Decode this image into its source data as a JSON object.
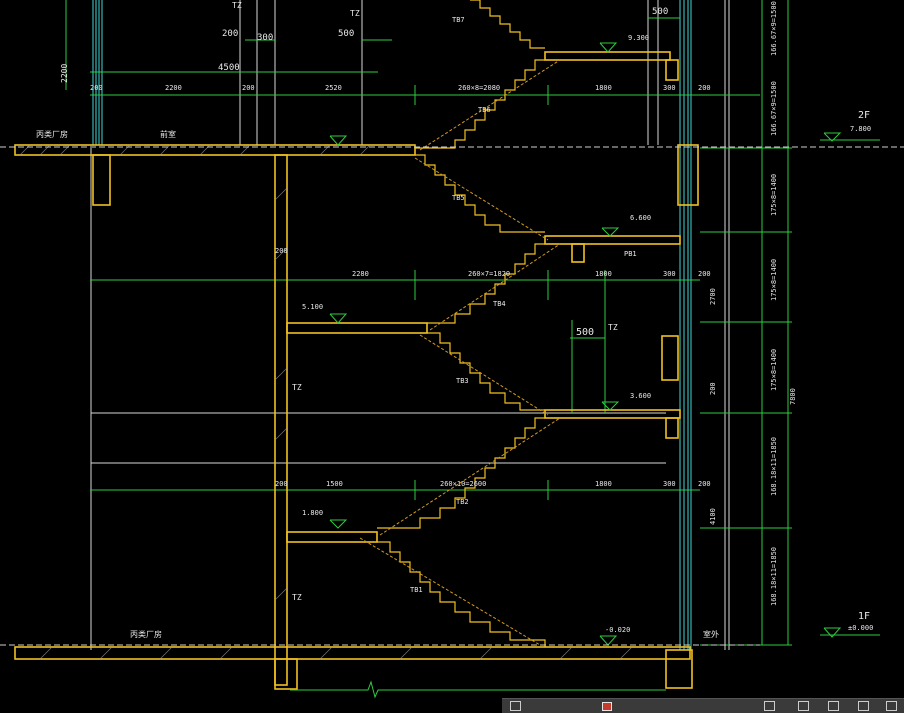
{
  "dims_top": [
    "200",
    "300",
    "500",
    "4500",
    "500",
    "9.300",
    "2200"
  ],
  "dim_row_a": [
    "200",
    "2200",
    "200",
    "2520",
    "260×8=2080",
    "1800",
    "300",
    "200"
  ],
  "dim_row_b": [
    "200",
    "2280",
    "260×7=1820",
    "1800",
    "300",
    "200"
  ],
  "dim_row_c": [
    "200",
    "1500",
    "260×10=2600",
    "1800",
    "300",
    "200"
  ],
  "room_labels": [
    "丙类厂房",
    "前室",
    "丙类厂房",
    "室外"
  ],
  "elevations": [
    "7.800",
    "6.600",
    "5.100",
    "3.600",
    "1.800",
    "-0.020",
    "±0.000"
  ],
  "stair_tags": [
    "TB7",
    "TB6",
    "TB5",
    "TB4",
    "TB3",
    "TB2",
    "TB1",
    "PB1"
  ],
  "column_tags": [
    "TZ",
    "TZ",
    "TZ",
    "TZ",
    "TZ"
  ],
  "right_dims": [
    "166.67×9=1500",
    "166.67×9=1500",
    "175×8=1400",
    "175×8=1400",
    "175×8=1400",
    "168.18×11=1850",
    "168.18×11=1850",
    "2700",
    "7800",
    "4100",
    "200",
    "500"
  ],
  "floor_tags": [
    "2F",
    "1F"
  ]
}
